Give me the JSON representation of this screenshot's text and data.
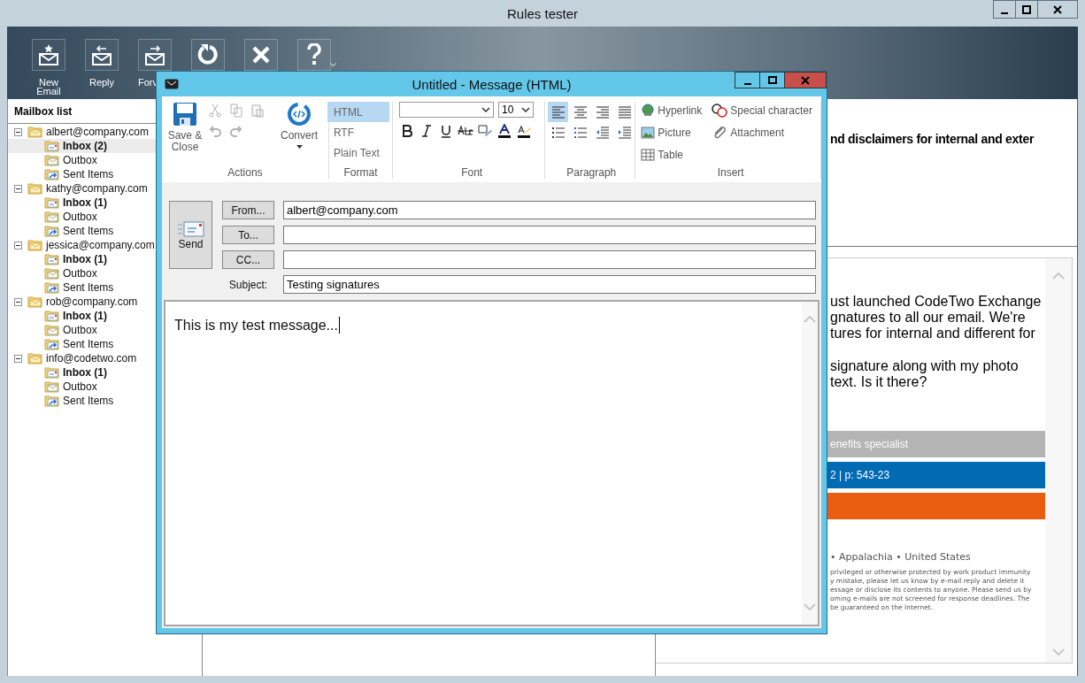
{
  "window": {
    "title": "Rules tester"
  },
  "toolbar": [
    {
      "kind": "new",
      "label": "New Email"
    },
    {
      "kind": "reply",
      "label": "Reply"
    },
    {
      "kind": "forward",
      "label": "Forv"
    },
    {
      "kind": "refresh"
    },
    {
      "kind": "delete"
    },
    {
      "kind": "help"
    }
  ],
  "mailbox_list": {
    "title": "Mailbox list",
    "accounts": [
      {
        "name": "albert@company.com",
        "expanded": true,
        "children": [
          {
            "kind": "inbox",
            "label": "Inbox (2)",
            "selected": true
          },
          {
            "kind": "outbox",
            "label": "Outbox",
            "selected": false
          },
          {
            "kind": "sent",
            "label": "Sent Items",
            "selected": false
          }
        ]
      },
      {
        "name": "kathy@company.com",
        "expanded": true,
        "children": [
          {
            "kind": "inbox",
            "label": "Inbox (1)",
            "selected": false
          },
          {
            "kind": "outbox",
            "label": "Outbox",
            "selected": false
          },
          {
            "kind": "sent",
            "label": "Sent Items",
            "selected": false
          }
        ]
      },
      {
        "name": "jessica@company.com",
        "expanded": true,
        "children": [
          {
            "kind": "inbox",
            "label": "Inbox (1)",
            "selected": false
          },
          {
            "kind": "outbox",
            "label": "Outbox",
            "selected": false
          },
          {
            "kind": "sent",
            "label": "Sent Items",
            "selected": false
          }
        ]
      },
      {
        "name": "rob@company.com",
        "expanded": true,
        "children": [
          {
            "kind": "inbox",
            "label": "Inbox (1)",
            "selected": false
          },
          {
            "kind": "outbox",
            "label": "Outbox",
            "selected": false
          },
          {
            "kind": "sent",
            "label": "Sent Items",
            "selected": false
          }
        ]
      },
      {
        "name": "info@codetwo.com",
        "expanded": true,
        "children": [
          {
            "kind": "inbox",
            "label": "Inbox (1)",
            "selected": false
          },
          {
            "kind": "outbox",
            "label": "Outbox",
            "selected": false
          },
          {
            "kind": "sent",
            "label": "Sent Items",
            "selected": false
          }
        ]
      }
    ]
  },
  "preview": {
    "subject": "nd disclaimers for internal and exter",
    "paragraphs": [
      [
        "ust launched CodeTwo Exchange",
        "gnatures to all our email. We're",
        "tures for internal and different for"
      ],
      [
        "signature along with my photo",
        "text. Is it there?"
      ]
    ],
    "signature_bars": [
      {
        "text": "enefits specialist",
        "color": "#b4b4b4"
      },
      {
        "text": "2 | p: 543-23",
        "color": "#006ab3"
      },
      {
        "color": "#e85d10"
      }
    ],
    "address": "• Appalachia • United States",
    "disclaimer": [
      "privileged or otherwise protected by work product immunity",
      "y mistake, please let us know by e-mail reply and delete it",
      "essage or disclose its contents to anyone. Please send us by",
      "oming e-mails are not screened for response deadlines. The",
      "be guaranteed on the Internet."
    ]
  },
  "message_window": {
    "title": "Untitled - Message (HTML)",
    "actions": {
      "label": "Actions",
      "save": "Save & Close",
      "convert": "Convert",
      "tools": [
        {
          "kind": "cut",
          "disabled": true
        },
        {
          "kind": "copy",
          "disabled": true
        },
        {
          "kind": "paste",
          "disabled": true
        },
        {
          "kind": "undo",
          "disabled": true
        },
        {
          "kind": "redo",
          "disabled": true
        }
      ]
    },
    "format": {
      "label": "Format",
      "options": [
        {
          "label": "HTML",
          "selected": true
        },
        {
          "label": "RTF",
          "selected": false
        },
        {
          "label": "Plain Text",
          "selected": false
        }
      ]
    },
    "font": {
      "label": "Font",
      "size": "10",
      "tools": [
        {
          "kind": "bold"
        },
        {
          "kind": "italic"
        },
        {
          "kind": "underline"
        },
        {
          "kind": "strike"
        },
        {
          "kind": "spell"
        },
        {
          "kind": "color"
        },
        {
          "kind": "highlight"
        }
      ]
    },
    "paragraph": {
      "label": "Paragraph",
      "align": [
        {
          "kind": "left",
          "selected": true
        },
        {
          "kind": "center",
          "selected": false
        },
        {
          "kind": "right",
          "selected": false
        },
        {
          "kind": "justify",
          "selected": false
        }
      ],
      "lists": [
        {
          "kind": "bullets"
        },
        {
          "kind": "numbers"
        },
        {
          "kind": "outdent"
        },
        {
          "kind": "indent"
        }
      ]
    },
    "insert": {
      "label": "Insert",
      "items": [
        {
          "kind": "hyperlink",
          "label": "Hyperlink"
        },
        {
          "kind": "picture",
          "label": "Picture"
        },
        {
          "kind": "table",
          "label": "Table"
        },
        {
          "kind": "special",
          "label": "Special character"
        },
        {
          "kind": "attachment",
          "label": "Attachment"
        }
      ]
    },
    "send": "Send",
    "fields": [
      {
        "button": "From...",
        "value": "albert@company.com"
      },
      {
        "button": "To..."
      },
      {
        "button": "CC..."
      }
    ],
    "subject": {
      "label": "Subject:",
      "value": "Testing signatures"
    },
    "body": "This is my test message..."
  }
}
